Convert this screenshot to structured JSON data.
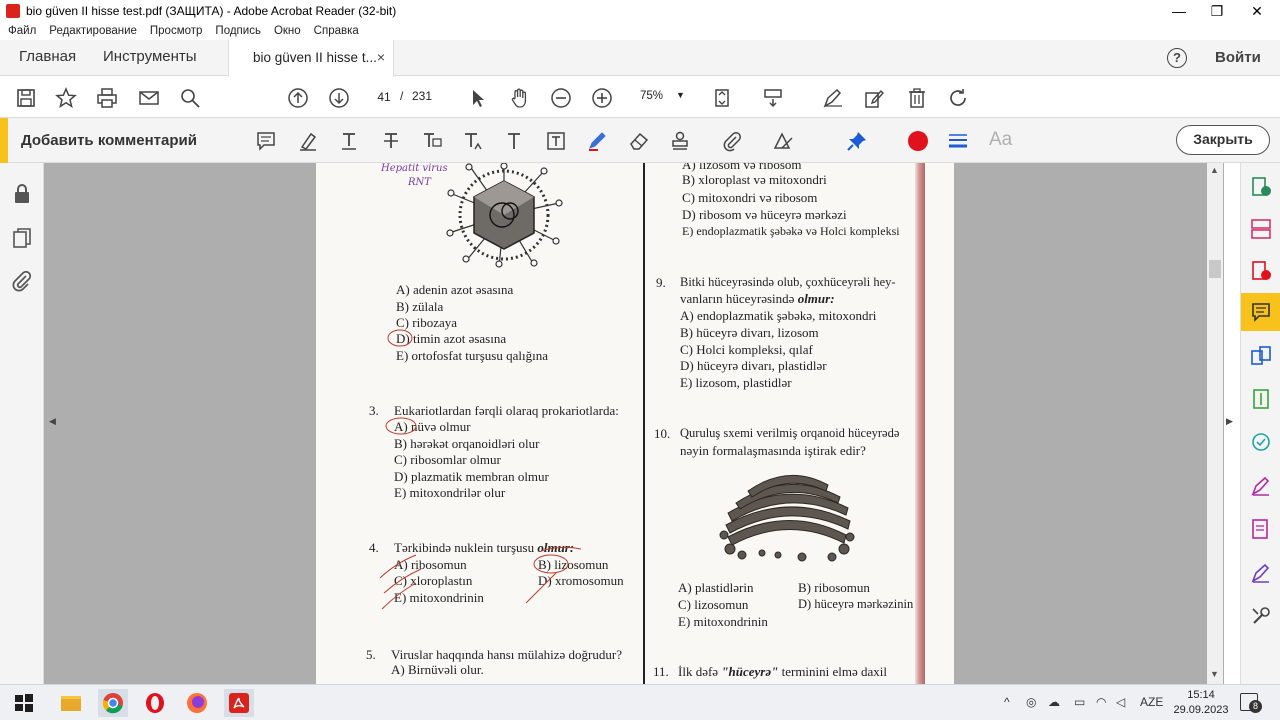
{
  "window": {
    "title": "bio güven II hisse test.pdf (ЗАЩИТА) - Adobe Acrobat Reader (32-bit)",
    "minimize": "—",
    "maximize": "❐",
    "close": "✕"
  },
  "menu": [
    "Файл",
    "Редактирование",
    "Просмотр",
    "Подпись",
    "Окно",
    "Справка"
  ],
  "tabs": {
    "home": "Главная",
    "tools": "Инструменты",
    "document": "bio güven II hisse t...",
    "document_close": "×",
    "help": "?",
    "login": "Войти"
  },
  "toolbar": {
    "page_current": "41",
    "page_sep": "/",
    "page_total": "231",
    "zoom": "75%"
  },
  "comment_bar": {
    "title": "Добавить комментарий",
    "close_label": "Закрыть",
    "font_label": "Aa",
    "accent_color": "#f7c21b",
    "record_color": "#e0121e",
    "pin_color": "#1d5bd6"
  },
  "document": {
    "left_column": {
      "q2_options": [
        "A) adenin azot əsasına",
        "B) zülala",
        "C) ribozaya",
        "D) timin azot əsasına",
        "E) ortofosfat turşusu qalığına"
      ],
      "q3": {
        "number": "3.",
        "text": "Eukariotlardan fərqli olaraq prokariotlarda:",
        "options": [
          "A) nüvə olmur",
          "B) hərəkət orqanoidləri olur",
          "C) ribosomlar olmur",
          "D) plazmatik membran olmur",
          "E) mitoxondrilər olur"
        ]
      },
      "q4": {
        "number": "4.",
        "text": "Tərkibində nuklein turşusu",
        "emph": "olmur:",
        "options_left": [
          "A) ribosomun",
          "C) xloroplastın",
          "E) mitoxondrinin"
        ],
        "options_right": [
          "B) lizosomun",
          "D) xromosomun"
        ]
      },
      "q5": {
        "number": "5.",
        "text": "Viruslar haqqında hansı mülahizə doğrudur?",
        "options": [
          "A) Birnüvəli olur."
        ]
      },
      "handwriting": [
        "Hepatit virus",
        "RNT"
      ]
    },
    "right_column": {
      "q8_options": [
        "A) lizosom və ribosom",
        "B) xloroplast və mitoxondri",
        "C) mitoxondri və ribosom",
        "D) ribosom və hüceyrə mərkəzi",
        "E) endoplazmatik şəbəkə və Holci kompleksi"
      ],
      "q9": {
        "number": "9.",
        "line1": "Bitki hüceyrəsində olub, çoxhüceyrəli hey-",
        "line2": "vanların hüceyrəsində",
        "emph": "olmur:",
        "options": [
          "A) endoplazmatik şəbəkə, mitoxondri",
          "B) hüceyrə divarı, lizosom",
          "C) Holci kompleksi, qılaf",
          "D) hüceyrə divarı, plastidlər",
          "E) lizosom, plastidlər"
        ]
      },
      "q10": {
        "number": "10.",
        "line1": "Quruluş sxemi verilmiş orqanoid hüceyrədə",
        "line2": "nəyin formalaşmasında iştirak edir?",
        "options_left": [
          "A) plastidlərin",
          "C) lizosomun",
          "E) mitoxondrinin"
        ],
        "options_right": [
          "B) ribosomun",
          "D) hüceyrə mərkəzinin"
        ]
      },
      "q11": {
        "number": "11.",
        "text": "İlk dəfə",
        "emph": "\"hüceyrə\"",
        "rest": "terminini elmə daxil"
      }
    }
  },
  "taskbar": {
    "language": "AZE",
    "time": "15:14",
    "date": "29.09.2023",
    "notifications": "8"
  }
}
